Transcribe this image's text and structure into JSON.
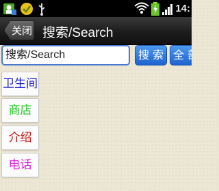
{
  "status_bar": {
    "time": "14:",
    "icons": [
      "app-notification-icon",
      "gold-app-icon",
      "usb-icon",
      "wifi-icon",
      "battery-charging-icon",
      "signal-icon"
    ]
  },
  "title_bar": {
    "back_label": "关闭",
    "title": "搜索/Search"
  },
  "search": {
    "placeholder": "搜索/Search",
    "search_button": "搜 索",
    "all_button": "全 部"
  },
  "categories": [
    {
      "label": "卫生间",
      "color": "#1a1ad6"
    },
    {
      "label": "商店",
      "color": "#1ec81e"
    },
    {
      "label": "介绍",
      "color": "#d01010"
    },
    {
      "label": "电话",
      "color": "#dd1edd"
    }
  ]
}
